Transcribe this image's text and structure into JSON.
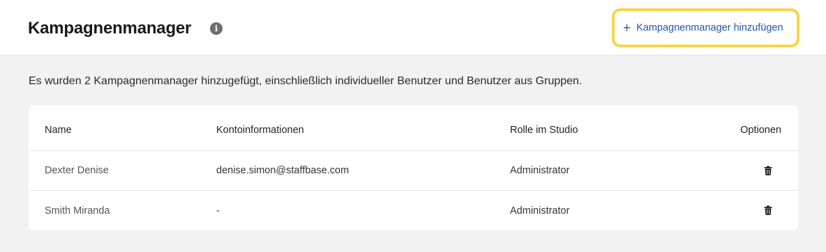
{
  "header": {
    "title": "Kampagnenmanager",
    "info_icon": "info-icon",
    "add_button": {
      "icon": "plus-icon",
      "icon_glyph": "+",
      "label": "Kampagnenmanager hinzufügen"
    }
  },
  "summary": "Es wurden 2 Kampagnenmanager hinzugefügt, einschließlich individueller Benutzer und Benutzer aus Gruppen.",
  "table": {
    "columns": {
      "name": "Name",
      "account": "Kontoinformationen",
      "role": "Rolle im Studio",
      "options": "Optionen"
    },
    "rows": [
      {
        "name": "Dexter Denise",
        "account": "denise.simon@staffbase.com",
        "role": "Administrator",
        "option_icon": "trash-icon"
      },
      {
        "name": "Smith Miranda",
        "account": "-",
        "role": "Administrator",
        "option_icon": "trash-icon"
      }
    ]
  },
  "colors": {
    "accent": "#1f54b5",
    "highlight": "#f6d64a",
    "background": "#f2f2f2"
  }
}
